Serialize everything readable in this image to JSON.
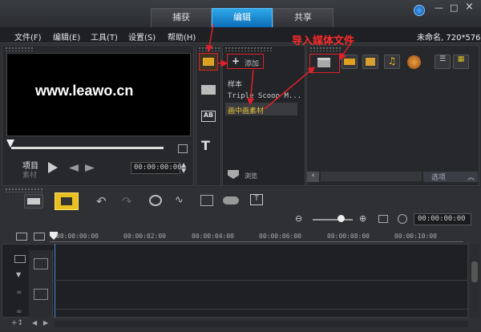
{
  "tabs": [
    {
      "label": "捕获"
    },
    {
      "label": "编辑"
    },
    {
      "label": "共享"
    }
  ],
  "window_controls": {
    "min": "—",
    "restore": "□",
    "close": "×"
  },
  "menu": [
    {
      "label": "文件(F)"
    },
    {
      "label": "编辑(E)"
    },
    {
      "label": "工具(T)"
    },
    {
      "label": "设置(S)"
    },
    {
      "label": "帮助(H)"
    }
  ],
  "project_info": "未命名, 720*576",
  "preview": {
    "watermark": "www.leawo.cn",
    "mode_project": "项目",
    "mode_clip": "素材",
    "timecode": "00:00:00:00"
  },
  "library": {
    "add_label": "添加",
    "items": [
      {
        "label": "样本"
      },
      {
        "label": "Triple Scoop M..."
      },
      {
        "label": "画中画素材"
      }
    ],
    "browse_label": "浏览",
    "options_label": "选项"
  },
  "annotation": "导入媒体文件",
  "timeline": {
    "timecode": "00:00:00:00",
    "ruler": [
      "00:00:00:00",
      "00:00:02:00",
      "00:00:04:00",
      "00:00:06:00",
      "00:00:08:00",
      "00:00:10:00"
    ],
    "zoom_level": 0.7
  },
  "colors": {
    "accent": "#1a8ad6",
    "annotation": "#e0202a",
    "highlight_item": "#e8c23a"
  }
}
